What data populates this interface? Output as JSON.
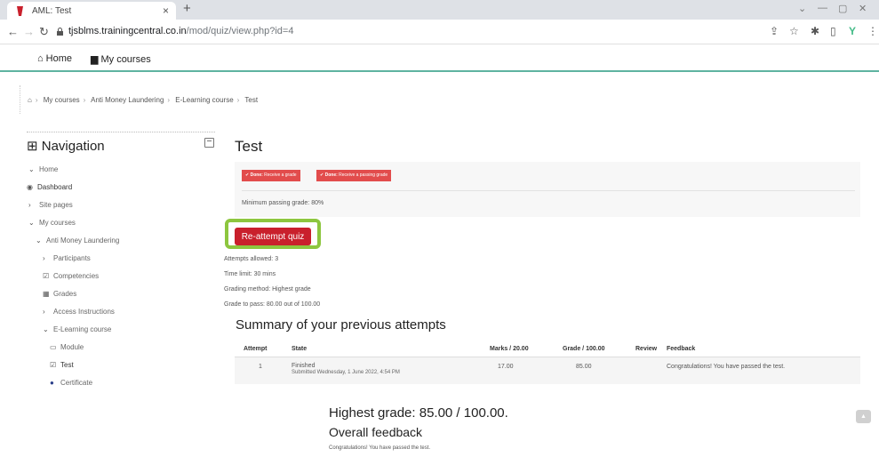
{
  "browser": {
    "tab_title": "AML: Test",
    "tab_close": "×",
    "new_tab": "+",
    "url_host": "tjsblms.trainingcentral.co.in",
    "url_path": "/mod/quiz/view.php?id=4"
  },
  "sitenav": {
    "home": "Home",
    "my_courses": "My courses"
  },
  "breadcrumb": [
    "My courses",
    "Anti Money Laundering",
    "E-Learning course",
    "Test"
  ],
  "navigation": {
    "title": "Navigation",
    "items": [
      {
        "label": "Home",
        "icon": "chevron-down-icon"
      },
      {
        "label": "Dashboard",
        "icon": "dashboard-icon"
      },
      {
        "label": "Site pages",
        "icon": "chevron-right-icon"
      },
      {
        "label": "My courses",
        "icon": "chevron-down-icon"
      },
      {
        "label": "Anti Money Laundering",
        "icon": "chevron-down-icon"
      },
      {
        "label": "Participants",
        "icon": "chevron-right-icon"
      },
      {
        "label": "Competencies",
        "icon": "check-square-icon"
      },
      {
        "label": "Grades",
        "icon": "table-icon"
      },
      {
        "label": "Access Instructions",
        "icon": "chevron-right-icon"
      },
      {
        "label": "E-Learning course",
        "icon": "chevron-down-icon"
      },
      {
        "label": "Module",
        "icon": "package-icon"
      },
      {
        "label": "Test",
        "icon": "quiz-icon"
      },
      {
        "label": "Certificate",
        "icon": "certificate-icon"
      }
    ]
  },
  "main": {
    "title": "Test",
    "completion": [
      {
        "prefix": "Done:",
        "text": "Receive a grade"
      },
      {
        "prefix": "Done:",
        "text": "Receive a passing grade"
      }
    ],
    "badge_color": "#e24c4c",
    "minimum_passing": "Minimum passing grade: 80%",
    "reattempt_label": "Re-attempt quiz",
    "info": [
      "Attempts allowed: 3",
      "Time limit: 30 mins",
      "Grading method: Highest grade",
      "Grade to pass: 80.00 out of 100.00"
    ],
    "summary_title": "Summary of your previous attempts",
    "table": {
      "headers": [
        "Attempt",
        "State",
        "Marks / 20.00",
        "Grade / 100.00",
        "Review",
        "Feedback"
      ],
      "rows": [
        {
          "attempt": "1",
          "state": "Finished",
          "submitted": "Submitted Wednesday, 1 June 2022, 4:54 PM",
          "marks": "17.00",
          "grade": "85.00",
          "review": "",
          "feedback": "Congratulations! You have passed the test."
        }
      ]
    },
    "highest_grade": "Highest grade: 85.00 / 100.00.",
    "overall_feedback_title": "Overall feedback",
    "overall_feedback_text": "Congratulations! You have passed the test."
  }
}
